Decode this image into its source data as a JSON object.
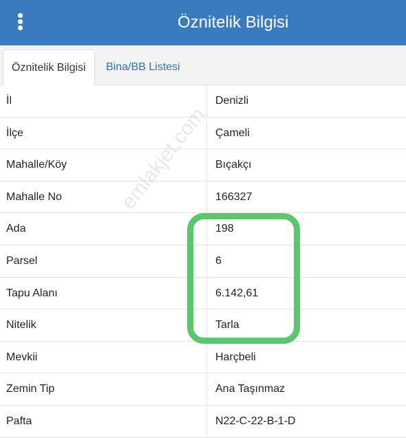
{
  "header": {
    "title": "Öznitelik Bilgisi",
    "menu_icon": "vertical-dots-icon",
    "background_color": "#3a7bbf"
  },
  "tabs": [
    {
      "label": "Öznitelik Bilgisi",
      "active": true
    },
    {
      "label": "Bina/BB Listesi",
      "active": false
    }
  ],
  "rows": [
    {
      "label": "İl",
      "value": "Denizli"
    },
    {
      "label": "İlçe",
      "value": "Çameli"
    },
    {
      "label": "Mahalle/Köy",
      "value": "Bıçakçı"
    },
    {
      "label": "Mahalle No",
      "value": "166327"
    },
    {
      "label": "Ada",
      "value": "198"
    },
    {
      "label": "Parsel",
      "value": "6"
    },
    {
      "label": "Tapu Alanı",
      "value": "6.142,61"
    },
    {
      "label": "Nitelik",
      "value": "Tarla"
    },
    {
      "label": "Mevkii",
      "value": "Harçbeli"
    },
    {
      "label": "Zemin Tip",
      "value": "Ana Taşınmaz"
    },
    {
      "label": "Pafta",
      "value": "N22-C-22-B-1-D"
    }
  ],
  "watermark": "emlakjet.com",
  "highlight_color": "#5cc66f"
}
